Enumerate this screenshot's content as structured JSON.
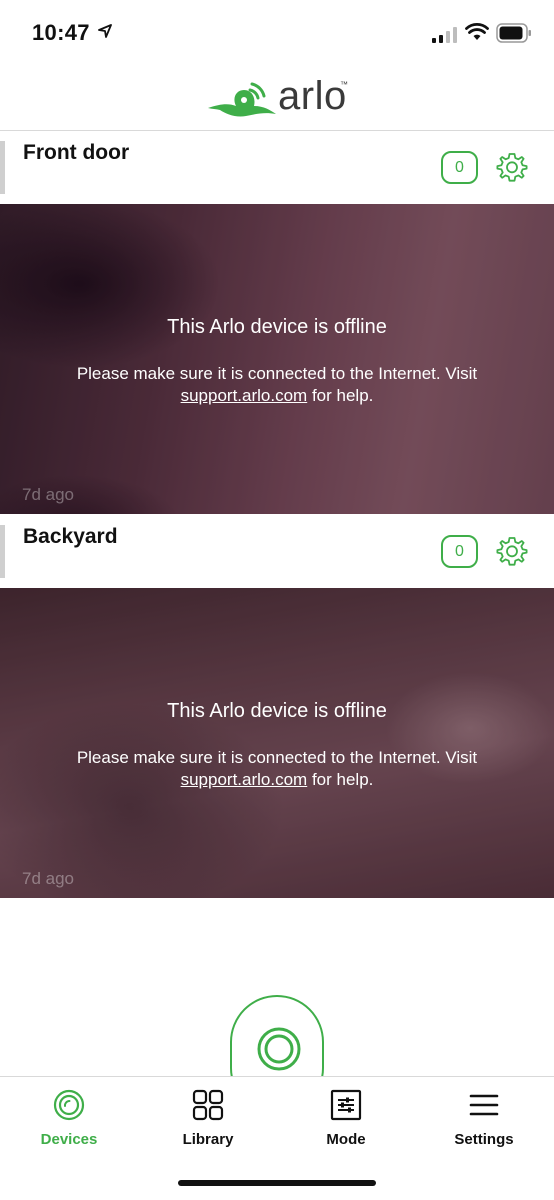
{
  "status_bar": {
    "time": "10:47",
    "icons": [
      "location-arrow-icon",
      "cellular-signal-icon",
      "wifi-icon",
      "battery-icon"
    ]
  },
  "header": {
    "logo_text": "arlo",
    "logo_tm": "™"
  },
  "colors": {
    "accent": "#3fae49",
    "text": "#111111",
    "divider": "#d9d9d9"
  },
  "cameras": [
    {
      "name": "Front door",
      "clip_count": "0",
      "offline_title": "This Arlo device is offline",
      "offline_message": "Please make sure it is connected to the Internet. Visit",
      "support_link": "support.arlo.com",
      "help_suffix": "for help.",
      "last_seen": "7d ago"
    },
    {
      "name": "Backyard",
      "clip_count": "0",
      "offline_title": "This Arlo device is offline",
      "offline_message": "Please make sure it is connected to the Internet. Visit",
      "support_link": "support.arlo.com",
      "help_suffix": "for help.",
      "last_seen": "7d ago"
    }
  ],
  "tabs": [
    {
      "label": "Devices",
      "icon": "devices-icon",
      "active": true
    },
    {
      "label": "Library",
      "icon": "grid-icon",
      "active": false
    },
    {
      "label": "Mode",
      "icon": "sliders-icon",
      "active": false
    },
    {
      "label": "Settings",
      "icon": "menu-icon",
      "active": false
    }
  ]
}
